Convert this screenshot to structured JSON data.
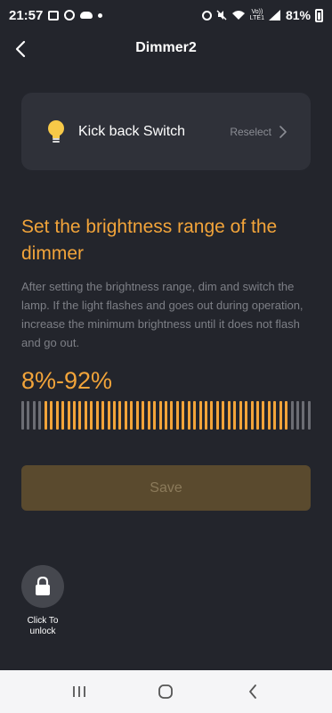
{
  "status_bar": {
    "time": "21:57",
    "volte_line1": "Vo))",
    "volte_line2": "LTE1",
    "battery_percent": "81%"
  },
  "header": {
    "title": "Dimmer2"
  },
  "switch_card": {
    "name": "Kick back Switch",
    "action_label": "Reselect"
  },
  "section": {
    "heading": "Set the brightness range of the dimmer",
    "description": "After setting the brightness range, dim and switch the lamp. If the light flashes and goes out during operation, increase the minimum brightness until it does not flash and go out."
  },
  "range": {
    "display": "8%-92%",
    "min_percent": 8,
    "max_percent": 92
  },
  "save_label": "Save",
  "lock": {
    "label_line1": "Click To",
    "label_line2": "unlock"
  },
  "colors": {
    "accent": "#f2a43a",
    "background": "#23252c",
    "card": "#2f3139",
    "inactive_tick": "#6b6d74",
    "save_disabled_bg": "#5a4a2e"
  },
  "icons": {
    "back": "chevron-left-icon",
    "bulb": "light-bulb-icon",
    "reselect": "chevron-right-icon",
    "lock": "lock-icon"
  }
}
